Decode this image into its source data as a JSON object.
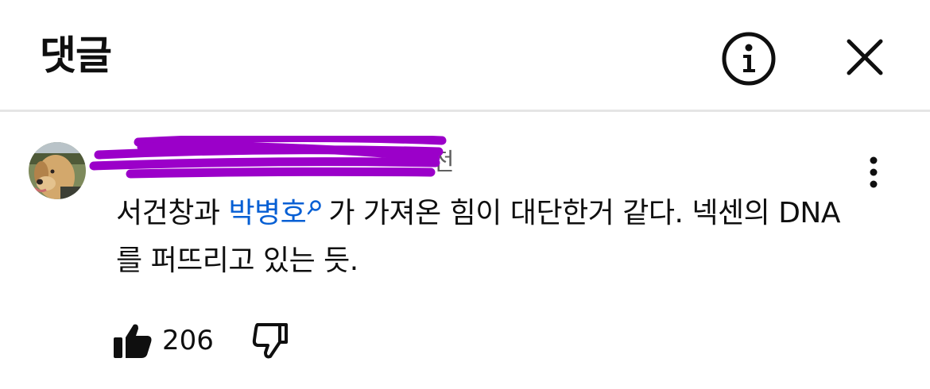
{
  "header": {
    "title": "댓글",
    "info_icon": "info-circle-icon",
    "close_icon": "close-icon"
  },
  "comment": {
    "author": "",
    "time": "전",
    "text_before": "서건창과 ",
    "mention": "박병호",
    "text_after": "가 가져온 힘이 대단한거 같다. 넥센의 DNA를 퍼뜨리고 있는 듯.",
    "like_count": "206",
    "more_icon": "more-vertical-icon",
    "like_icon": "thumbs-up-icon",
    "dislike_icon": "thumbs-down-icon"
  },
  "colors": {
    "redaction": "#9b00c9",
    "link": "#065fd4",
    "divider": "#e5e5e5",
    "secondary_text": "#606060"
  }
}
